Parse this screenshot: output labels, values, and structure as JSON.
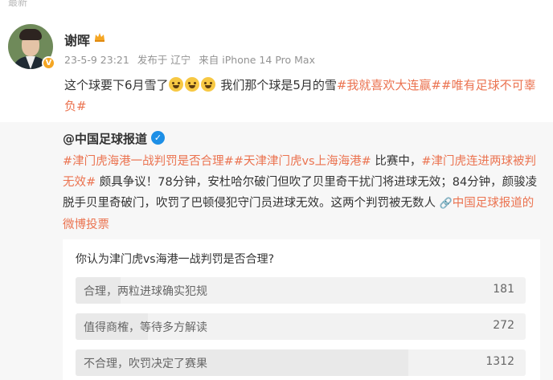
{
  "top_cut_text": "最新",
  "post": {
    "author": "谢晖",
    "timestamp": "23-5-9 23:21",
    "location": "发布于 辽宁",
    "device": "来自 iPhone 14 Pro Max",
    "text_1": "这个球要下6月雪了",
    "text_2": " 我们那个球是5月的雪",
    "tag_1": "#我就喜欢大连赢#",
    "tag_2": "#唯有足球不可辜负#"
  },
  "repost": {
    "author": "@中国足球报道",
    "tag_a": "#津门虎海港一战判罚是否合理#",
    "tag_b": "#天津津门虎vs上海海港#",
    "text_a": " 比赛中，",
    "tag_c": "#津门虎连进两球被判无效#",
    "text_b": " 颇具争议！78分钟，安杜哈尔破门但吹了贝里奇干扰门将进球无效；84分钟，颜骏凌脱手贝里奇破门，吹罚了巴顿侵犯守门员进球无效。这两个判罚被无数人 ",
    "link_text": "中国足球报道的微博投票"
  },
  "poll": {
    "question": "你认为津门虎vs海港一战判罚是否合理?",
    "options": [
      {
        "label": "合理，两粒进球确实犯规",
        "count": "181",
        "share": 0.1
      },
      {
        "label": "值得商榷，等待多方解读",
        "count": "272",
        "share": 0.16
      },
      {
        "label": "不合理，吹罚决定了赛果",
        "count": "1312",
        "share": 0.74
      }
    ]
  },
  "icons": {
    "verified_badge": "orange-v-badge",
    "crown": "crown-icon",
    "emoji": "crying-laughing-emoji",
    "repost_verified": "blue-verified-icon",
    "link": "link-icon"
  },
  "colors": {
    "accent": "#eb7350",
    "repost_bg": "#f7f7f7",
    "verified_blue": "#1d8fe6",
    "badge_orange": "#f5a623"
  }
}
